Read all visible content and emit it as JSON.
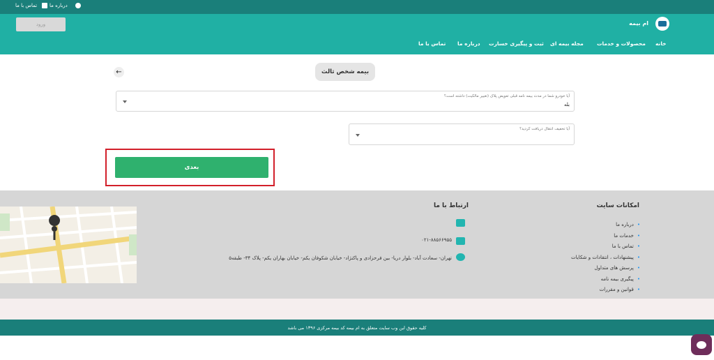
{
  "topbar": {
    "about": "درباره ما",
    "contact": "تماس با ما"
  },
  "header": {
    "brand": "ام بیمه",
    "login_button": "ورود",
    "nav": [
      "خانه",
      "محصولات و خدمات",
      "مجله بیمه ای",
      "ثبت و پیگیری خسارت",
      "درباره ما",
      "تماس با ما"
    ]
  },
  "main": {
    "page_title": "بیمه شخص ثالث",
    "q1_label": "آیا خودرو شما در مدت بیمه نامه قبلی تعویض پلاک (تغییر مالکیت) داشته است؟",
    "q1_value": "بله",
    "q2_label": "آیا تخفیف انتقال دریافت کردید؟",
    "q2_value": "",
    "next_button": "بعدی"
  },
  "footer": {
    "features_title": "امکانات سایت",
    "features": [
      "درباره ما",
      "خدمات ما",
      "تماس با ما",
      "پیشنهادات ، انتقادات و شکایات",
      "پرسش های متداول",
      "پیگیری بیمه نامه",
      "قوانین و مقررات"
    ],
    "contact_title": "ارتباط با ما",
    "phone": "۰۲۱-۸۸۵۶۶۹۵۵",
    "address": "تهران- سعادت آباد- بلوار دریا- بین فرحزادی و پاکنژاد- خیابان شکوفان یکم- خیابان بهاران یکم- پلاک ۳۴- طبقه۵",
    "copyright": "کلیه حقوق این وب سایت متعلق به ام بیمه کد بیمه مرکزی ۱۳۹۶ می باشد"
  },
  "colors": {
    "topbar": "#1a7f7a",
    "header": "#20b0a4",
    "primary_button": "#2fb16e",
    "highlight": "#d21f2a",
    "footer": "#d6d6d6"
  }
}
